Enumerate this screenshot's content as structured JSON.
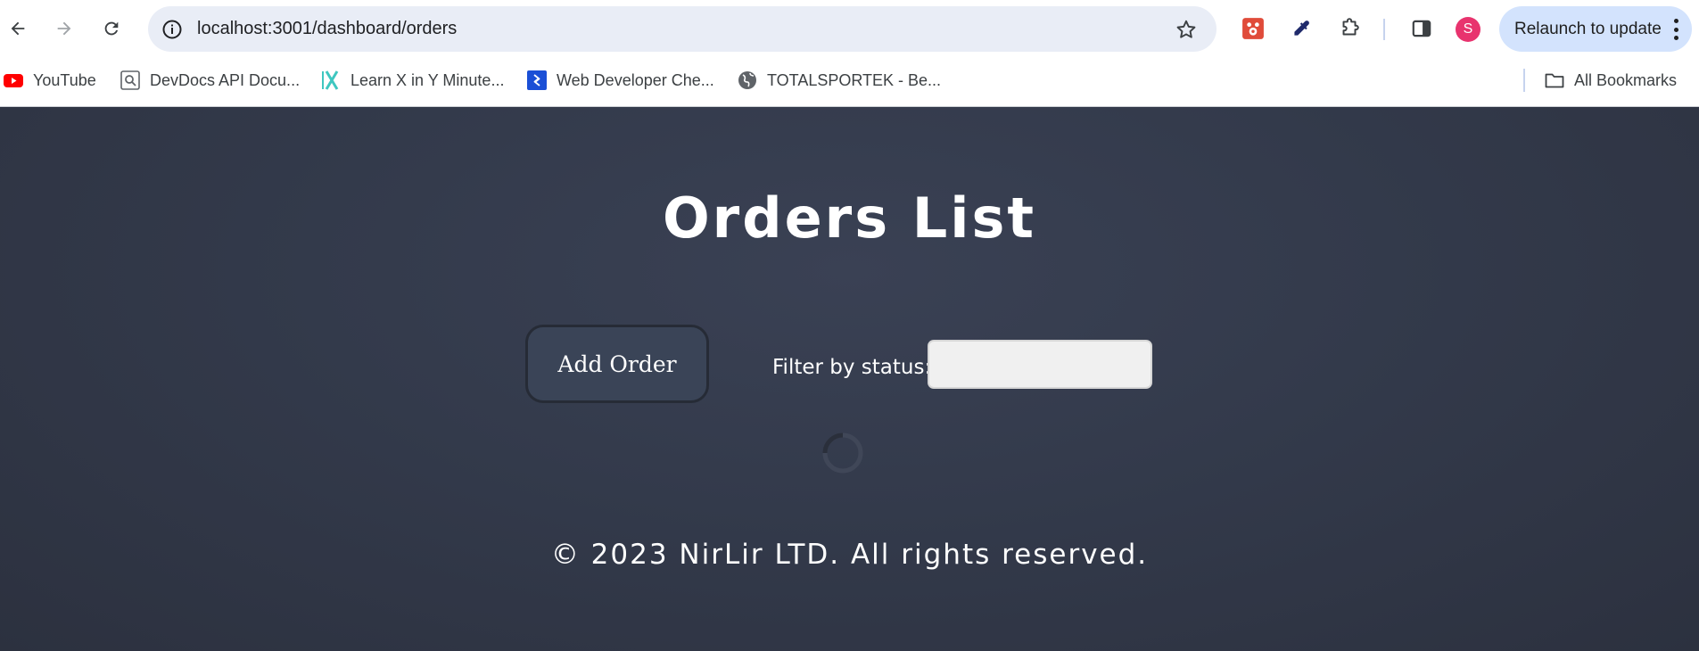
{
  "browser": {
    "url": "localhost:3001/dashboard/orders",
    "relaunch_label": "Relaunch to update",
    "profile_initial": "S",
    "bookmarks": [
      {
        "label": "YouTube",
        "icon": "youtube-icon"
      },
      {
        "label": "DevDocs API Docu...",
        "icon": "devdocs-icon"
      },
      {
        "label": "Learn X in Y Minute...",
        "icon": "learnx-icon"
      },
      {
        "label": "Web Developer Che...",
        "icon": "webdev-icon"
      },
      {
        "label": "TOTALSPORTEK - Be...",
        "icon": "globe-icon"
      }
    ],
    "all_bookmarks_label": "All Bookmarks"
  },
  "page": {
    "title": "Orders List",
    "add_order_label": "Add Order",
    "filter_label": "Filter by status:",
    "filter_value": "",
    "footer": "© 2023 NirLir LTD. All rights reserved."
  },
  "colors": {
    "page_background": "#333a4b",
    "button_background": "#3a4457",
    "relaunch_background": "#d3e3fd",
    "avatar": "#e8336e"
  }
}
